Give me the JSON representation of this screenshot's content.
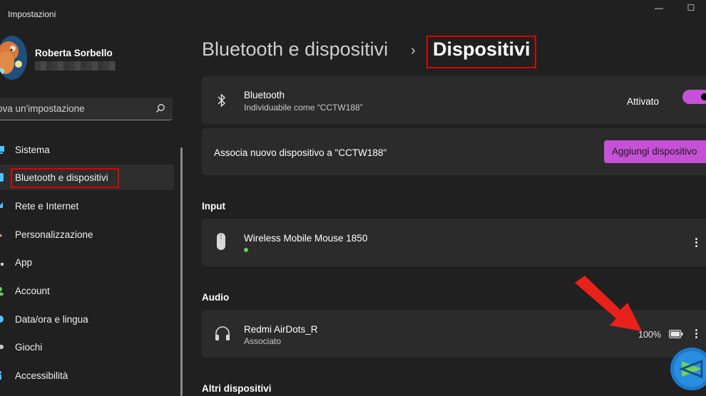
{
  "window": {
    "title": "Impostazioni",
    "minimize_glyph": "—",
    "maximize_glyph": "☐"
  },
  "profile": {
    "name": "Roberta Sorbello"
  },
  "search": {
    "placeholder": "ova un'impostazione",
    "icon": "search-icon"
  },
  "sidebar": {
    "items": [
      {
        "label": "Sistema",
        "icon": "monitor-icon",
        "color": "#4cc2ff"
      },
      {
        "label": "Bluetooth e dispositivi",
        "icon": "bluetooth-devices-icon",
        "color": "#4cc2ff",
        "active": true
      },
      {
        "label": "Rete e Internet",
        "icon": "network-icon",
        "color": "#4cc2ff"
      },
      {
        "label": "Personalizzazione",
        "icon": "brush-icon",
        "color": "#e8a25b"
      },
      {
        "label": "App",
        "icon": "apps-icon",
        "color": "#c9c9c9"
      },
      {
        "label": "Account",
        "icon": "account-icon",
        "color": "#6ccb5f"
      },
      {
        "label": "Data/ora e lingua",
        "icon": "globe-icon",
        "color": "#4cc2ff"
      },
      {
        "label": "Giochi",
        "icon": "gamepad-icon",
        "color": "#c9c9c9"
      },
      {
        "label": "Accessibilità",
        "icon": "accessibility-icon",
        "color": "#4cc2ff"
      }
    ]
  },
  "breadcrumb": {
    "parent": "Bluetooth e dispositivi",
    "separator": "›",
    "current": "Dispositivi"
  },
  "bluetooth": {
    "title": "Bluetooth",
    "subtitle": "Individuabile come “CCTW188”",
    "toggle_label": "Attivato",
    "toggle_on": true,
    "accent": "#c751d6"
  },
  "pair": {
    "text": "Associa nuovo dispositivo a \"CCTW188\"",
    "button": "Aggiungi dispositivo"
  },
  "sections": {
    "input": "Input",
    "audio": "Audio",
    "other": "Altri dispositivi"
  },
  "devices": {
    "mouse": {
      "name": "Wireless Mobile Mouse 1850",
      "icon": "mouse-icon",
      "status_color": "#6ccb5f"
    },
    "headphones": {
      "name": "Redmi AirDots_R",
      "status": "Associato",
      "battery": "100%",
      "battery_level": 1.0,
      "icon": "headphones-icon"
    }
  },
  "colors": {
    "highlight_box": "#e00000",
    "arrow": "#e8211a"
  }
}
